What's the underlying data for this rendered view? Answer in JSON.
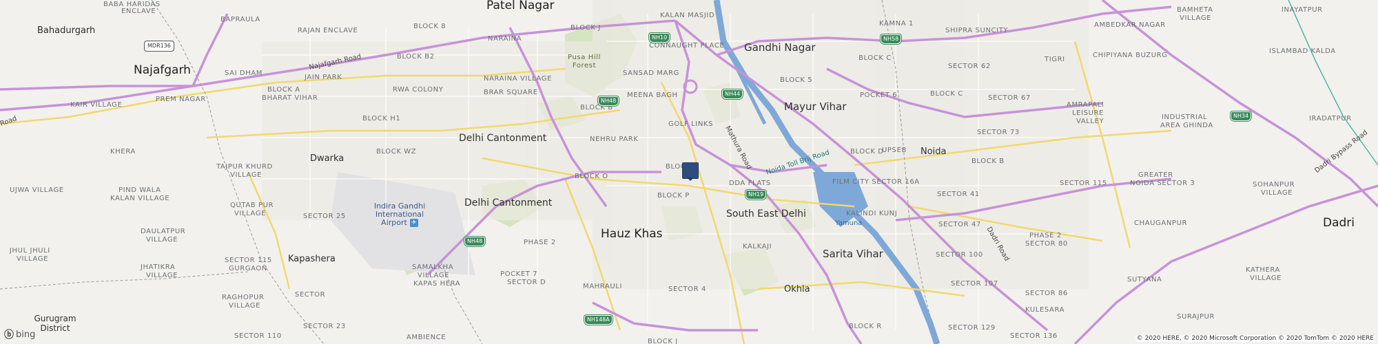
{
  "map": {
    "labels": {
      "bahadurgarh": "Bahadurgarh",
      "najafgarh": "Najafgarh",
      "dwarka": "Dwarka",
      "kapashera": "Kapashera",
      "gurugram_district": "Gurugram District",
      "patel_nagar": "Patel Nagar",
      "delhi_cantonment_1": "Delhi Cantonment",
      "delhi_cantonment_2": "Delhi Cantonment",
      "hauz_khas": "Hauz Khas",
      "gandhi_nagar": "Gandhi Nagar",
      "mayur_vihar": "Mayur Vihar",
      "south_east_delhi": "South East Delhi",
      "sarita_vihar": "Sarita Vihar",
      "okhla": "Okhla",
      "noida": "Noida",
      "dadri": "Dadri",
      "yamuna": "Yamuna",
      "airport": "Indira Gandhi International Airport",
      "pusa_hill_forest": "Pusa Hill Forest",
      "najafgarh_road": "Najafgarh Road",
      "mathura_road": "Mathura Road",
      "noida_toll_bridge": "Noida Toll Brij Road",
      "dadri_road": "Dadri Road",
      "dadri_bypass_road": "Dadri Bypass Road",
      "road": "Road"
    },
    "localities": [
      {
        "id": "baba-haridas",
        "text": "BABA HARIDAS"
      },
      {
        "id": "enclave",
        "text": "ENCLAVE"
      },
      {
        "id": "bapraula",
        "text": "BAPRAULA"
      },
      {
        "id": "rajan-enclave",
        "text": "RAJAN ENCLAVE"
      },
      {
        "id": "sai-dham",
        "text": "SAI DHAM"
      },
      {
        "id": "jain-park",
        "text": "JAIN PARK"
      },
      {
        "id": "prem-nagar",
        "text": "PREM NAGAR"
      },
      {
        "id": "kair-village",
        "text": "KAIR VILLAGE"
      },
      {
        "id": "block-a-bharat-vihar",
        "text": "BLOCK A"
      },
      {
        "id": "bharat-vihar",
        "text": "BHARAT VIHAR"
      },
      {
        "id": "block-b2",
        "text": "BLOCK B2"
      },
      {
        "id": "rwa-colony",
        "text": "RWA COLONY"
      },
      {
        "id": "block-8",
        "text": "BLOCK 8"
      },
      {
        "id": "block-h1",
        "text": "BLOCK H1"
      },
      {
        "id": "block-wz",
        "text": "BLOCK WZ"
      },
      {
        "id": "khera",
        "text": "KHERA"
      },
      {
        "id": "tajpur-khurd",
        "text": "TAJPUR KHURD"
      },
      {
        "id": "tajpur-village",
        "text": "VILLAGE"
      },
      {
        "id": "ujwa-village",
        "text": "UJWA VILLAGE"
      },
      {
        "id": "pind-wala",
        "text": "PIND WALA"
      },
      {
        "id": "kalan-village",
        "text": "KALAN VILLAGE"
      },
      {
        "id": "qutab-pur",
        "text": "QUTAB PUR"
      },
      {
        "id": "qutab-village",
        "text": "VILLAGE"
      },
      {
        "id": "sector-25",
        "text": "SECTOR 25"
      },
      {
        "id": "daulatpur",
        "text": "DAULATPUR"
      },
      {
        "id": "daulatpur-village",
        "text": "VILLAGE"
      },
      {
        "id": "jhul-jhuli",
        "text": "JHUL JHULI"
      },
      {
        "id": "jhul-village",
        "text": "VILLAGE"
      },
      {
        "id": "jhatikra",
        "text": "JHATIKRA"
      },
      {
        "id": "jhatikra-village",
        "text": "VILLAGE"
      },
      {
        "id": "sector-115",
        "text": "SECTOR 115"
      },
      {
        "id": "gurgaon",
        "text": "GURGAON"
      },
      {
        "id": "raghopur",
        "text": "RAGHOPUR"
      },
      {
        "id": "raghopur-village",
        "text": "VILLAGE"
      },
      {
        "id": "sector-gurugram",
        "text": "SECTOR"
      },
      {
        "id": "sector-23",
        "text": "SECTOR 23"
      },
      {
        "id": "sector-110",
        "text": "SECTOR 110"
      },
      {
        "id": "samalkha",
        "text": "SAMALKHA"
      },
      {
        "id": "samalkha-village",
        "text": "VILLAGE"
      },
      {
        "id": "kapas-hera",
        "text": "KAPAS HERA"
      },
      {
        "id": "ambience",
        "text": "AMBIENCE"
      },
      {
        "id": "naraina",
        "text": "NARAINA"
      },
      {
        "id": "naraina-village",
        "text": "NARAINA VILLAGE"
      },
      {
        "id": "brar-square",
        "text": "BRAR SQUARE"
      },
      {
        "id": "block-j",
        "text": "BLOCK J"
      },
      {
        "id": "block-b",
        "text": "BLOCK B"
      },
      {
        "id": "nehru-park",
        "text": "NEHRU PARK"
      },
      {
        "id": "block-o",
        "text": "BLOCK O"
      },
      {
        "id": "phase-2",
        "text": "PHASE 2"
      },
      {
        "id": "pocket-7",
        "text": "POCKET 7"
      },
      {
        "id": "sector-d",
        "text": "SECTOR D"
      },
      {
        "id": "mahrauli",
        "text": "MAHRAULI"
      },
      {
        "id": "kalan-masjid",
        "text": "KALAN MASJID"
      },
      {
        "id": "connaught-place",
        "text": "CONNAUGHT PLACE"
      },
      {
        "id": "sansad-marg",
        "text": "SANSAD MARG"
      },
      {
        "id": "meena-bagh",
        "text": "MEENA BAGH"
      },
      {
        "id": "golf-links",
        "text": "GOLF LINKS"
      },
      {
        "id": "block-partial",
        "text": "BLOCK"
      },
      {
        "id": "block-p",
        "text": "BLOCK P"
      },
      {
        "id": "dda-flats",
        "text": "DDA FLATS"
      },
      {
        "id": "kalkaji",
        "text": "KALKAJI"
      },
      {
        "id": "sector-4",
        "text": "SECTOR 4"
      },
      {
        "id": "block-j-south",
        "text": "BLOCK J"
      },
      {
        "id": "kamna-1",
        "text": "KAMNA 1"
      },
      {
        "id": "shipra-suncity",
        "text": "SHIPRA SUNCITY"
      },
      {
        "id": "block-c",
        "text": "BLOCK C"
      },
      {
        "id": "block-5",
        "text": "BLOCK 5"
      },
      {
        "id": "pocket-6",
        "text": "POCKET 6"
      },
      {
        "id": "sector-62",
        "text": "SECTOR 62"
      },
      {
        "id": "block-c2",
        "text": "BLOCK C"
      },
      {
        "id": "block-d",
        "text": "BLOCK D"
      },
      {
        "id": "upseb",
        "text": "UPSEB"
      },
      {
        "id": "film-city",
        "text": "FILM CITY SECTOR 16A"
      },
      {
        "id": "kalindi-kunj",
        "text": "KALINDI KUNJ"
      },
      {
        "id": "sector-41",
        "text": "SECTOR 41"
      },
      {
        "id": "sector-47",
        "text": "SECTOR 47"
      },
      {
        "id": "sector-100",
        "text": "SECTOR 100"
      },
      {
        "id": "sector-107",
        "text": "SECTOR 107"
      },
      {
        "id": "sector-129",
        "text": "SECTOR 129"
      },
      {
        "id": "sector-136",
        "text": "SECTOR 136"
      },
      {
        "id": "block-r",
        "text": "BLOCK R"
      },
      {
        "id": "tigri",
        "text": "TIGRI"
      },
      {
        "id": "ambedkar-nagar",
        "text": "AMBEDKAR NAGAR"
      },
      {
        "id": "chipiyana-buzurg",
        "text": "CHIPIYANA BUZURG"
      },
      {
        "id": "sector-67",
        "text": "SECTOR 67"
      },
      {
        "id": "amrapali",
        "text": "AMRAPALI"
      },
      {
        "id": "amrapali-leisure",
        "text": "LEISURE"
      },
      {
        "id": "amrapali-valley",
        "text": "VALLEY"
      },
      {
        "id": "sector-73",
        "text": "SECTOR 73"
      },
      {
        "id": "block-b-noida",
        "text": "BLOCK B"
      },
      {
        "id": "sector-115-noida",
        "text": "SECTOR 115"
      },
      {
        "id": "greater-noida",
        "text": "GREATER"
      },
      {
        "id": "greater-noida-sector",
        "text": "NOIDA SECTOR 3"
      },
      {
        "id": "phase-2-noida",
        "text": "PHASE 2"
      },
      {
        "id": "sector-80",
        "text": "SECTOR 80"
      },
      {
        "id": "sector-86",
        "text": "SECTOR 86"
      },
      {
        "id": "kulesara",
        "text": "KULESARA"
      },
      {
        "id": "chauganpur",
        "text": "CHAUGANPUR"
      },
      {
        "id": "sutyana",
        "text": "SUTYANA"
      },
      {
        "id": "surajpur",
        "text": "SURAJPUR"
      },
      {
        "id": "industrial-area",
        "text": "INDUSTRIAL"
      },
      {
        "id": "industrial-greater",
        "text": "AREA GHINDA"
      },
      {
        "id": "sohanpur",
        "text": "SOHANPUR"
      },
      {
        "id": "sohanpur-village",
        "text": "VILLAGE"
      },
      {
        "id": "kathera",
        "text": "KATHERA"
      },
      {
        "id": "kathera-village",
        "text": "VILLAGE"
      },
      {
        "id": "bamheta",
        "text": "BAMHETA"
      },
      {
        "id": "bamheta-village",
        "text": "VILLAGE"
      },
      {
        "id": "inayatpur",
        "text": "INAYATPUR"
      },
      {
        "id": "islambad-kalda",
        "text": "ISLAMBAD KALDA"
      },
      {
        "id": "iradatpur",
        "text": "IRADATPUR"
      }
    ],
    "shields": {
      "mdr136": "MDR136",
      "nh10": "NH10",
      "nh48_north": "NH48",
      "nh48_south": "NH48",
      "nh44": "NH44",
      "nh19": "NH19",
      "nh58": "NH58",
      "nh34": "NH34",
      "nh148a": "NH148A"
    },
    "attribution": {
      "logo": "bing",
      "copyright": "© 2020 HERE, © 2020 Microsoft Corporation © 2020 TomTom © 2020 HERE"
    },
    "colors": {
      "background": "#f2f1ee",
      "highway": "#c792d8",
      "main_road": "#f1d86c",
      "water": "#7ea8d8",
      "park": "#c9dcae",
      "marker": "#2d4d7c"
    },
    "marker_icon": "location-marker-icon"
  }
}
